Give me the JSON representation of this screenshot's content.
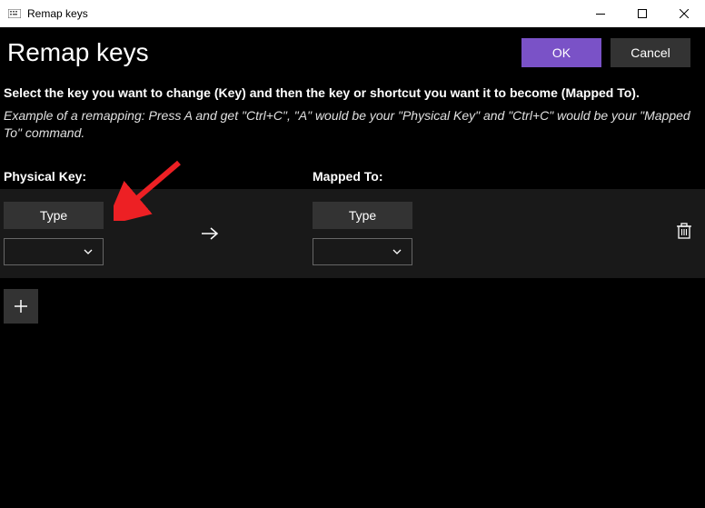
{
  "titlebar": {
    "title": "Remap keys"
  },
  "header": {
    "title": "Remap keys",
    "ok_label": "OK",
    "cancel_label": "Cancel"
  },
  "instructions": {
    "main": "Select the key you want to change (Key) and then the key or shortcut you want it to become (Mapped To).",
    "example": "Example of a remapping: Press A and get \"Ctrl+C\", \"A\" would be your \"Physical Key\" and \"Ctrl+C\" would be your \"Mapped To\" command."
  },
  "labels": {
    "physical": "Physical Key:",
    "mapped": "Mapped To:"
  },
  "mapping": {
    "type_label": "Type"
  }
}
